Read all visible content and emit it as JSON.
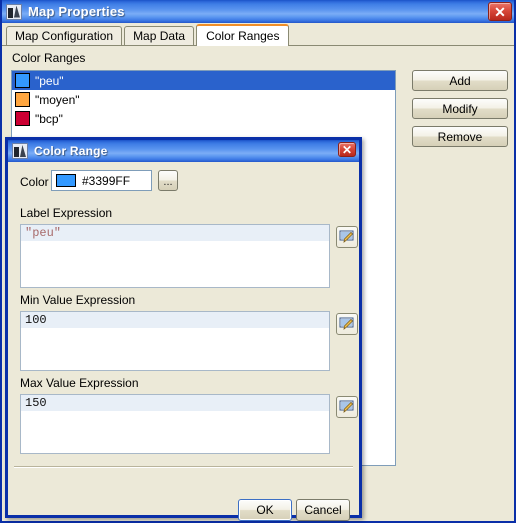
{
  "main_window": {
    "title": "Map Properties",
    "icon": "map-icon",
    "close_label": "✕",
    "tabs": [
      {
        "label": "Map Configuration",
        "active": false
      },
      {
        "label": "Map Data",
        "active": false
      },
      {
        "label": "Color Ranges",
        "active": true
      }
    ],
    "group_label": "Color Ranges",
    "list": {
      "rows": [
        {
          "label": "\"peu\"",
          "color": "#3399FF",
          "selected": true
        },
        {
          "label": "\"moyen\"",
          "color": "#FFA640",
          "selected": false
        },
        {
          "label": "\"bcp\"",
          "color": "#CC0033",
          "selected": false
        }
      ]
    },
    "buttons": {
      "add": "Add",
      "modify": "Modify",
      "remove": "Remove"
    }
  },
  "dialog": {
    "title": "Color Range",
    "icon": "map-icon",
    "close_label": "✕",
    "color": {
      "label": "Color",
      "value": "#3399FF",
      "swatch": "#3399FF",
      "picker_button": "...",
      "picker_icon": "ellipsis-icon"
    },
    "label_expression": {
      "label": "Label Expression",
      "value": "\"peu\"",
      "kind": "str",
      "editor_icon": "pencil-edit-icon"
    },
    "min_expression": {
      "label": "Min Value Expression",
      "value": "100",
      "kind": "num",
      "editor_icon": "pencil-edit-icon"
    },
    "max_expression": {
      "label": "Max Value Expression",
      "value": "150",
      "kind": "num",
      "editor_icon": "pencil-edit-icon"
    },
    "ok_label": "OK",
    "cancel_label": "Cancel"
  },
  "colors": {
    "title_blue": "#3f7ee6",
    "dialog_border": "#0a2fa8",
    "face": "#ece9d8",
    "selection": "#2a62cc",
    "tab_active_accent": "#f08e28",
    "expr_line": "#e8eff7",
    "expr_string_text": "#a86a6a"
  }
}
